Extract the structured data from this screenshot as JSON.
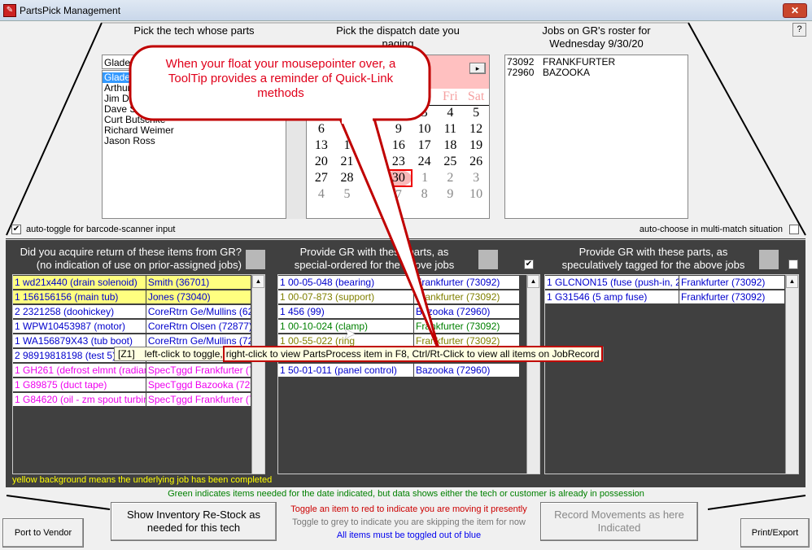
{
  "window": {
    "title": "PartsPick Management",
    "close": "✕",
    "help": "?"
  },
  "tech": {
    "header": "Pick the tech whose parts",
    "combo_value": "Glade",
    "items": [
      "Glade",
      "Arthur",
      "Jim Di",
      "Dave S",
      "Curt Butschke",
      "Richard Weimer",
      "Jason Ross"
    ],
    "selected": 0
  },
  "calendar": {
    "header1": "Pick the dispatch date you",
    "header2": "naging",
    "month_label": "020",
    "next": "▸",
    "dow": [
      "hu",
      "Fri",
      "Sat"
    ],
    "weeks": [
      [
        "",
        "",
        "",
        "",
        "3",
        "4",
        "5"
      ],
      [
        "6",
        "",
        "8",
        "9",
        "10",
        "11",
        "12"
      ],
      [
        "13",
        "1",
        "15",
        "16",
        "17",
        "18",
        "19"
      ],
      [
        "20",
        "21",
        "2",
        "23",
        "24",
        "25",
        "26"
      ],
      [
        "27",
        "28",
        "9",
        "30",
        "1",
        "2",
        "3"
      ],
      [
        "4",
        "5",
        "",
        "7",
        "8",
        "9",
        "10"
      ]
    ],
    "selected": "30"
  },
  "roster": {
    "header1": "Jobs on GR's roster for",
    "header2": "Wednesday 9/30/20",
    "items": [
      {
        "job": "73092",
        "name": "FRANKFURTER"
      },
      {
        "job": "72960",
        "name": "BAZOOKA"
      }
    ]
  },
  "options": {
    "auto_toggle": "auto-toggle for barcode-scanner input",
    "auto_toggle_checked": true,
    "auto_choose": "auto-choose in multi-match situation",
    "auto_choose_checked": false
  },
  "panels": [
    {
      "title1": "Did you acquire return of these items from GR?",
      "title2": "(no indication of use on prior-assigned jobs)",
      "rows": [
        {
          "item": "1  wd21x440 (drain solenoid)",
          "job": "Smith (36701)",
          "color": "#0000cc",
          "bg": "#ffff80"
        },
        {
          "item": "1  156156156 (main tub)",
          "job": "Jones (73040)",
          "color": "#0000cc",
          "bg": "#ffff80"
        },
        {
          "item": "2  2321258 (doohickey)",
          "job": "CoreRtrn Ge/Mullins (6292",
          "color": "#0000cc",
          "bg": "#ffffff"
        },
        {
          "item": "1  WPW10453987 (motor)",
          "job": "CoreRtrn Olsen (72877)",
          "color": "#0000cc",
          "bg": "#ffffff"
        },
        {
          "item": "1  WA156879X43 (tub boot)",
          "job": "CoreRtrn Ge/Mullins (7292",
          "color": "#0000cc",
          "bg": "#ffffff"
        },
        {
          "item": "2  98919818198 (test 5)",
          "job": "",
          "color": "#0000cc",
          "bg": "#ffffff"
        },
        {
          "item": "1  GH261 (defrost elmnt (radiant ln",
          "job": "SpecTggd Frankfurter (730",
          "color": "#ee00ee",
          "bg": "#ffffff"
        },
        {
          "item": "1  G89875 (duct tape)",
          "job": "SpecTggd Bazooka (72960",
          "color": "#ee00ee",
          "bg": "#ffffff"
        },
        {
          "item": "1  G84620 (oil - zm spout turbine)",
          "job": "SpecTggd Frankfurter (730",
          "color": "#ee00ee",
          "bg": "#ffffff"
        }
      ],
      "footnote": "yellow background means the underlying job has been completed"
    },
    {
      "title1": "Provide GR with these parts, as",
      "title2": "special-ordered for the above jobs",
      "checked": true,
      "rows": [
        {
          "item": "1  00-05-048 (bearing)",
          "job": "Frankfurter (73092)",
          "color": "#0000cc",
          "bg": "#ffffff"
        },
        {
          "item": "1  00-07-873 (support)",
          "job": "Frankfurter (73092)",
          "color": "#808000",
          "bg": "#ffffff"
        },
        {
          "item": "1  456 (99)",
          "job": "Bazooka (72960)",
          "color": "#0000cc",
          "bg": "#ffffff"
        },
        {
          "item": "1  00-10-024 (clamp)",
          "job": "Frankfurter (73092)",
          "color": "#008000",
          "bg": "#ffffff"
        },
        {
          "item": "1  00-55-022 (ring",
          "job": "Frankfurter (73092)",
          "color": "#808000",
          "bg": "#ffffff"
        },
        {
          "item": "",
          "job": "",
          "color": "#0000cc",
          "bg": "#ffffff"
        },
        {
          "item": "1  50-01-011 (panel control)",
          "job": "Bazooka (72960)",
          "color": "#0000cc",
          "bg": "#ffffff"
        }
      ]
    },
    {
      "title1": "Provide GR with these parts, as",
      "title2": "speculatively tagged for the above jobs",
      "checked": false,
      "rows": [
        {
          "item": "1  GLCNON15 (fuse (push-in, 2.00",
          "job": "Frankfurter (73092)",
          "color": "#0000cc",
          "bg": "#ffffff"
        },
        {
          "item": "1  G31546 (5 amp fuse)",
          "job": "Frankfurter (73092)",
          "color": "#0000cc",
          "bg": "#ffffff"
        }
      ]
    }
  ],
  "tooltip": {
    "prefix": "[Z1]",
    "left": "left-click to toggle,",
    "right": "right-click to view PartsProcess item in F8, Ctrl/Rt-Click to view all items on JobRecord"
  },
  "callout": {
    "text": "When your float your mousepointer over, a ToolTip provides a reminder of Quick-Link methods"
  },
  "bottom": {
    "green_note": "Green indicates items needed for the date indicated, but data shows either the tech or customer is already in possession",
    "restock": "Show Inventory Re-Stock as needed for this tech",
    "red_note": "Toggle an item to red to indicate you are moving it presently",
    "grey_note": "Toggle to grey to indicate you are skipping the item for now",
    "blue_note": "All items must be toggled out of blue",
    "record": "Record Movements as here Indicated",
    "port": "Port to Vendor",
    "print": "Print/Export"
  }
}
